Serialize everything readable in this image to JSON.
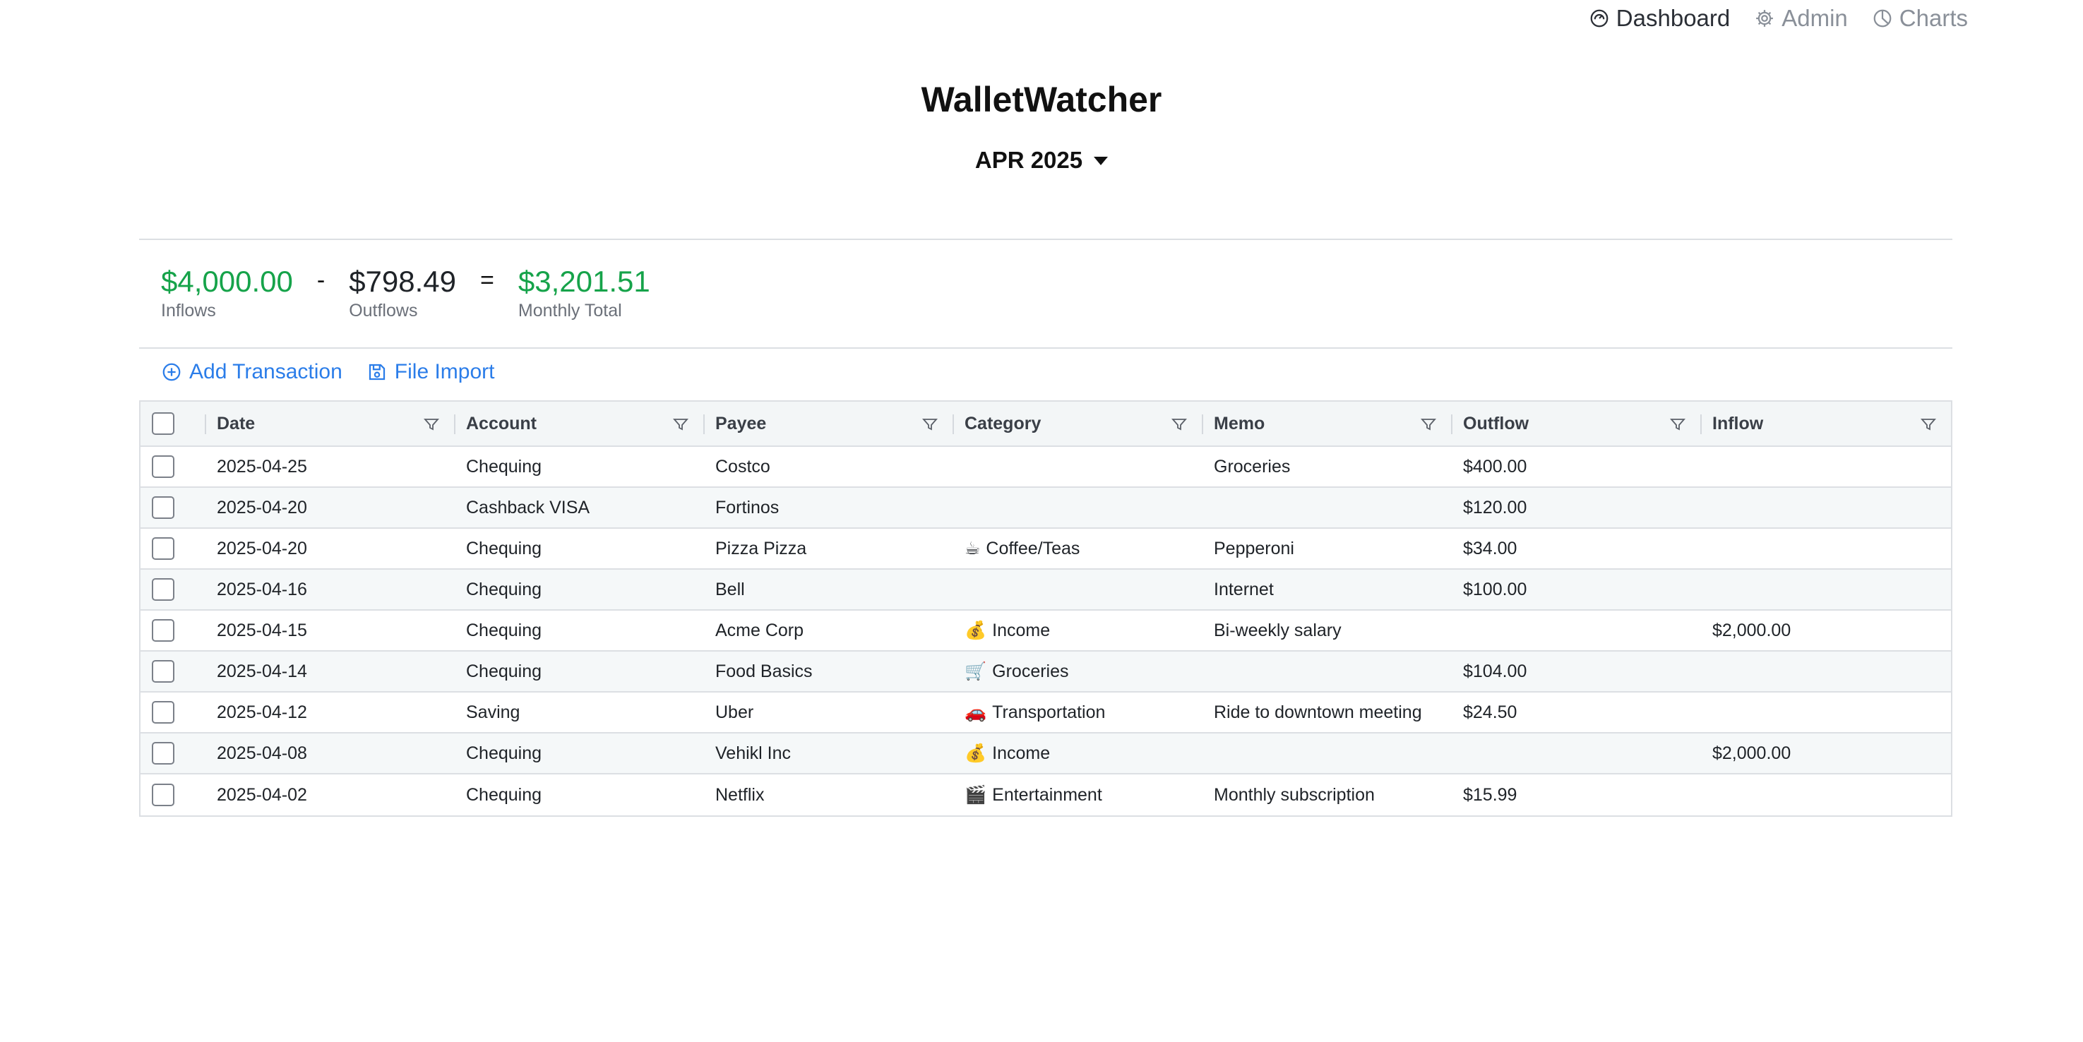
{
  "nav": {
    "items": [
      {
        "label": "Dashboard",
        "icon": "dashboard-gauge-icon",
        "active": true
      },
      {
        "label": "Admin",
        "icon": "gear-icon",
        "active": false
      },
      {
        "label": "Charts",
        "icon": "pie-chart-icon",
        "active": false
      }
    ]
  },
  "app": {
    "title": "WalletWatcher"
  },
  "month": {
    "label": "APR 2025"
  },
  "summary": {
    "inflows": {
      "amount": "$4,000.00",
      "label": "Inflows"
    },
    "minus": "-",
    "outflows": {
      "amount": "$798.49",
      "label": "Outflows"
    },
    "equals": "=",
    "total": {
      "amount": "$3,201.51",
      "label": "Monthly Total"
    }
  },
  "toolbar": {
    "add_label": "Add Transaction",
    "import_label": "File Import"
  },
  "table": {
    "columns": [
      "Date",
      "Account",
      "Payee",
      "Category",
      "Memo",
      "Outflow",
      "Inflow"
    ],
    "rows": [
      {
        "date": "2025-04-25",
        "account": "Chequing",
        "payee": "Costco",
        "cat_emoji": "",
        "category": "",
        "memo": "Groceries",
        "outflow": "$400.00",
        "inflow": ""
      },
      {
        "date": "2025-04-20",
        "account": "Cashback VISA",
        "payee": "Fortinos",
        "cat_emoji": "",
        "category": "",
        "memo": "",
        "outflow": "$120.00",
        "inflow": ""
      },
      {
        "date": "2025-04-20",
        "account": "Chequing",
        "payee": "Pizza Pizza",
        "cat_emoji": "☕",
        "category": "Coffee/Teas",
        "memo": "Pepperoni",
        "outflow": "$34.00",
        "inflow": ""
      },
      {
        "date": "2025-04-16",
        "account": "Chequing",
        "payee": "Bell",
        "cat_emoji": "",
        "category": "",
        "memo": "Internet",
        "outflow": "$100.00",
        "inflow": ""
      },
      {
        "date": "2025-04-15",
        "account": "Chequing",
        "payee": "Acme Corp",
        "cat_emoji": "💰",
        "category": "Income",
        "memo": "Bi-weekly salary",
        "outflow": "",
        "inflow": "$2,000.00"
      },
      {
        "date": "2025-04-14",
        "account": "Chequing",
        "payee": "Food Basics",
        "cat_emoji": "🛒",
        "category": "Groceries",
        "memo": "",
        "outflow": "$104.00",
        "inflow": ""
      },
      {
        "date": "2025-04-12",
        "account": "Saving",
        "payee": "Uber",
        "cat_emoji": "🚗",
        "category": "Transportation",
        "memo": "Ride to downtown meeting",
        "outflow": "$24.50",
        "inflow": ""
      },
      {
        "date": "2025-04-08",
        "account": "Chequing",
        "payee": "Vehikl Inc",
        "cat_emoji": "💰",
        "category": "Income",
        "memo": "",
        "outflow": "",
        "inflow": "$2,000.00"
      },
      {
        "date": "2025-04-02",
        "account": "Chequing",
        "payee": "Netflix",
        "cat_emoji": "🎬",
        "category": "Entertainment",
        "memo": "Monthly subscription",
        "outflow": "$15.99",
        "inflow": ""
      }
    ]
  },
  "colors": {
    "accent": "#2b7de9",
    "positive": "#16a34a",
    "row_alt": "#f5f8f9",
    "header_bg": "#f3f6f7"
  }
}
